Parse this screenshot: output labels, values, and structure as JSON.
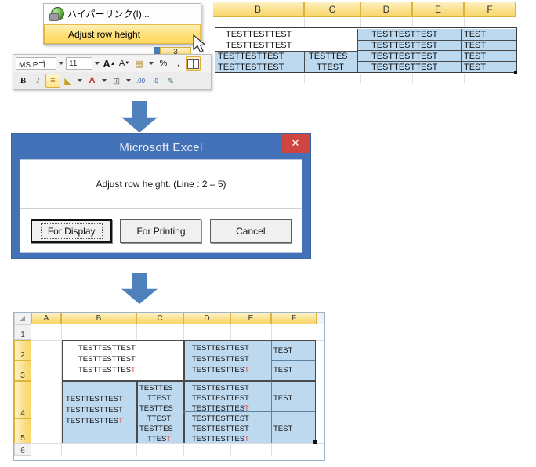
{
  "meta": {
    "flow_title": "Adjust row height",
    "accent_blue": "#4f81bd",
    "dialog_blue": "#4472b8",
    "selection_blue": "#bcd9f0",
    "header_yellow": "#f8d66a",
    "close_red": "#cf4540",
    "red_text": "#e8473f"
  },
  "panel1": {
    "context_menu": {
      "items": [
        {
          "label": "ハイパーリンク(I)...",
          "icon": "globe-icon",
          "highlighted": false
        },
        {
          "label": "Adjust row height",
          "icon": "none",
          "highlighted": true
        }
      ]
    },
    "mini_toolbar": {
      "font_name": "MS Pゴ",
      "font_size": "11",
      "buttons_row1": [
        {
          "name": "grow-font-button",
          "glyph": "A"
        },
        {
          "name": "shrink-font-button",
          "glyph": "A"
        },
        {
          "name": "format-painter-style-button",
          "glyph": "▤"
        },
        {
          "name": "percent-style-button",
          "glyph": "%"
        },
        {
          "name": "comma-style-button",
          "glyph": ","
        },
        {
          "name": "adjust-row-height-button",
          "glyph": "grid",
          "active": true
        }
      ],
      "buttons_row2": [
        {
          "name": "bold-button",
          "glyph": "B"
        },
        {
          "name": "italic-button",
          "glyph": "I"
        },
        {
          "name": "align-button",
          "glyph": "≡",
          "active": true
        },
        {
          "name": "fill-color-button",
          "glyph": "◆"
        },
        {
          "name": "font-color-button",
          "glyph": "A"
        },
        {
          "name": "borders-button",
          "glyph": "⊞"
        },
        {
          "name": "increase-decimal-button",
          "glyph": "·00"
        },
        {
          "name": "decrease-decimal-button",
          "glyph": "·0"
        },
        {
          "name": "format-painter-button",
          "glyph": "🖌"
        }
      ]
    },
    "sheet": {
      "column_headers": [
        "B",
        "C",
        "D",
        "E",
        "F"
      ],
      "row_header_visible": "3",
      "cells": {
        "b_block": [
          "TESTTESTTEST",
          "TESTTESTTEST",
          "TESTTESTTEST",
          "TESTTESTTEST"
        ],
        "c_block": [
          "TESTTES",
          "TTEST"
        ],
        "d_block": [
          "TESTTESTTEST",
          "TESTTESTTEST",
          "TESTTESTTEST",
          "TESTTESTTEST"
        ],
        "f_block": [
          "TEST",
          "TEST",
          "TEST",
          "TEST"
        ]
      }
    }
  },
  "dialog": {
    "title": "Microsoft Excel",
    "close_label": "✕",
    "message": "Adjust row height. (Line : 2 – 5)",
    "buttons": [
      {
        "label": "For Display",
        "focused": true
      },
      {
        "label": "For Printing",
        "focused": false
      },
      {
        "label": "Cancel",
        "focused": false
      }
    ]
  },
  "panel3": {
    "sheet": {
      "corner_label": "",
      "column_headers": [
        "A",
        "B",
        "C",
        "D",
        "E",
        "F"
      ],
      "row_headers": [
        "1",
        "2",
        "3",
        "4",
        "5",
        "6"
      ],
      "merged_regions": [
        {
          "name": "region-rows-2-3",
          "rows": "2-3",
          "b_lines": [
            "TESTTESTTEST",
            "TESTTESTTEST",
            "TESTTESTTEST"
          ],
          "b_last_char_red": true,
          "c_lines": [],
          "d_lines": [
            "TESTTESTTEST",
            "TESTTESTTEST",
            "TESTTESTTEST"
          ],
          "d_last_char_red": true,
          "f_lines": [
            "TEST",
            "TEST"
          ]
        },
        {
          "name": "region-rows-4-5",
          "rows": "4-5",
          "b_lines": [
            "TESTTESTTEST",
            "TESTTESTTEST",
            "TESTTESTTEST"
          ],
          "b_last_char_red": true,
          "c_lines": [
            "TESTTES",
            "TTEST",
            "TESTTES",
            "TTEST",
            "TESTTES",
            "TTEST"
          ],
          "c_last_char_red": true,
          "d_lines": [
            "TESTTESTTEST",
            "TESTTESTTEST",
            "TESTTESTTEST",
            "TESTTESTTEST",
            "TESTTESTTEST",
            "TESTTESTTEST"
          ],
          "d_last_char_red": true,
          "f_lines": [
            "TEST",
            "TEST"
          ]
        }
      ]
    }
  }
}
